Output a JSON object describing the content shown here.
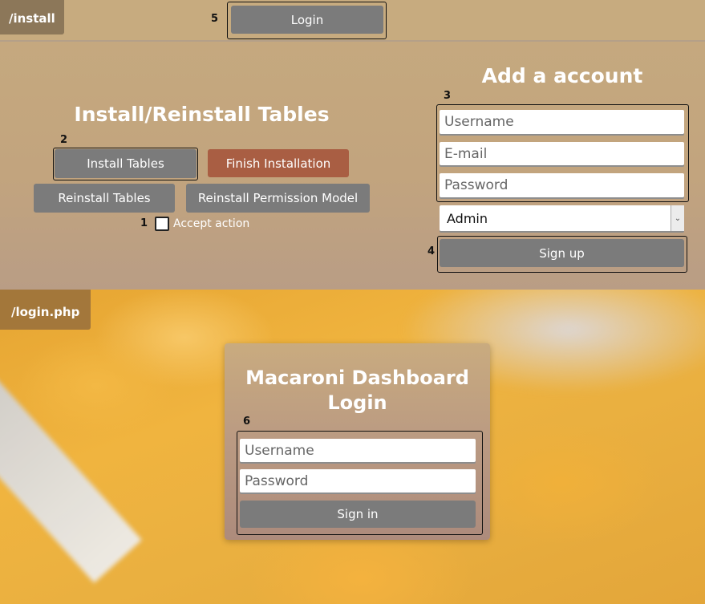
{
  "install_page": {
    "route_label": "/install",
    "login_button": "Login",
    "tables_section": {
      "title": "Install/Reinstall Tables",
      "install_tables": "Install Tables",
      "finish_installation": "Finish Installation",
      "reinstall_tables": "Reinstall Tables",
      "reinstall_permission_model": "Reinstall Permission Model",
      "accept_action_label": "Accept action",
      "accept_action_checked": false
    },
    "account_section": {
      "title": "Add a account",
      "username_placeholder": "Username",
      "email_placeholder": "E-mail",
      "password_placeholder": "Password",
      "role_selected": "Admin",
      "sign_up": "Sign up"
    }
  },
  "login_page": {
    "route_label": "/login.php",
    "title_line1": "Macaroni Dashboard",
    "title_line2": "Login",
    "username_placeholder": "Username",
    "password_placeholder": "Password",
    "sign_in": "Sign in"
  },
  "markers": {
    "m1": "1",
    "m2": "2",
    "m3": "3",
    "m4": "4",
    "m5": "5",
    "m6": "6"
  },
  "colors": {
    "button_gray": "#7b7b7b",
    "finish_button": "#a95e43",
    "panel_tan": "#c4a57e",
    "route_tag": "#8c7759"
  }
}
